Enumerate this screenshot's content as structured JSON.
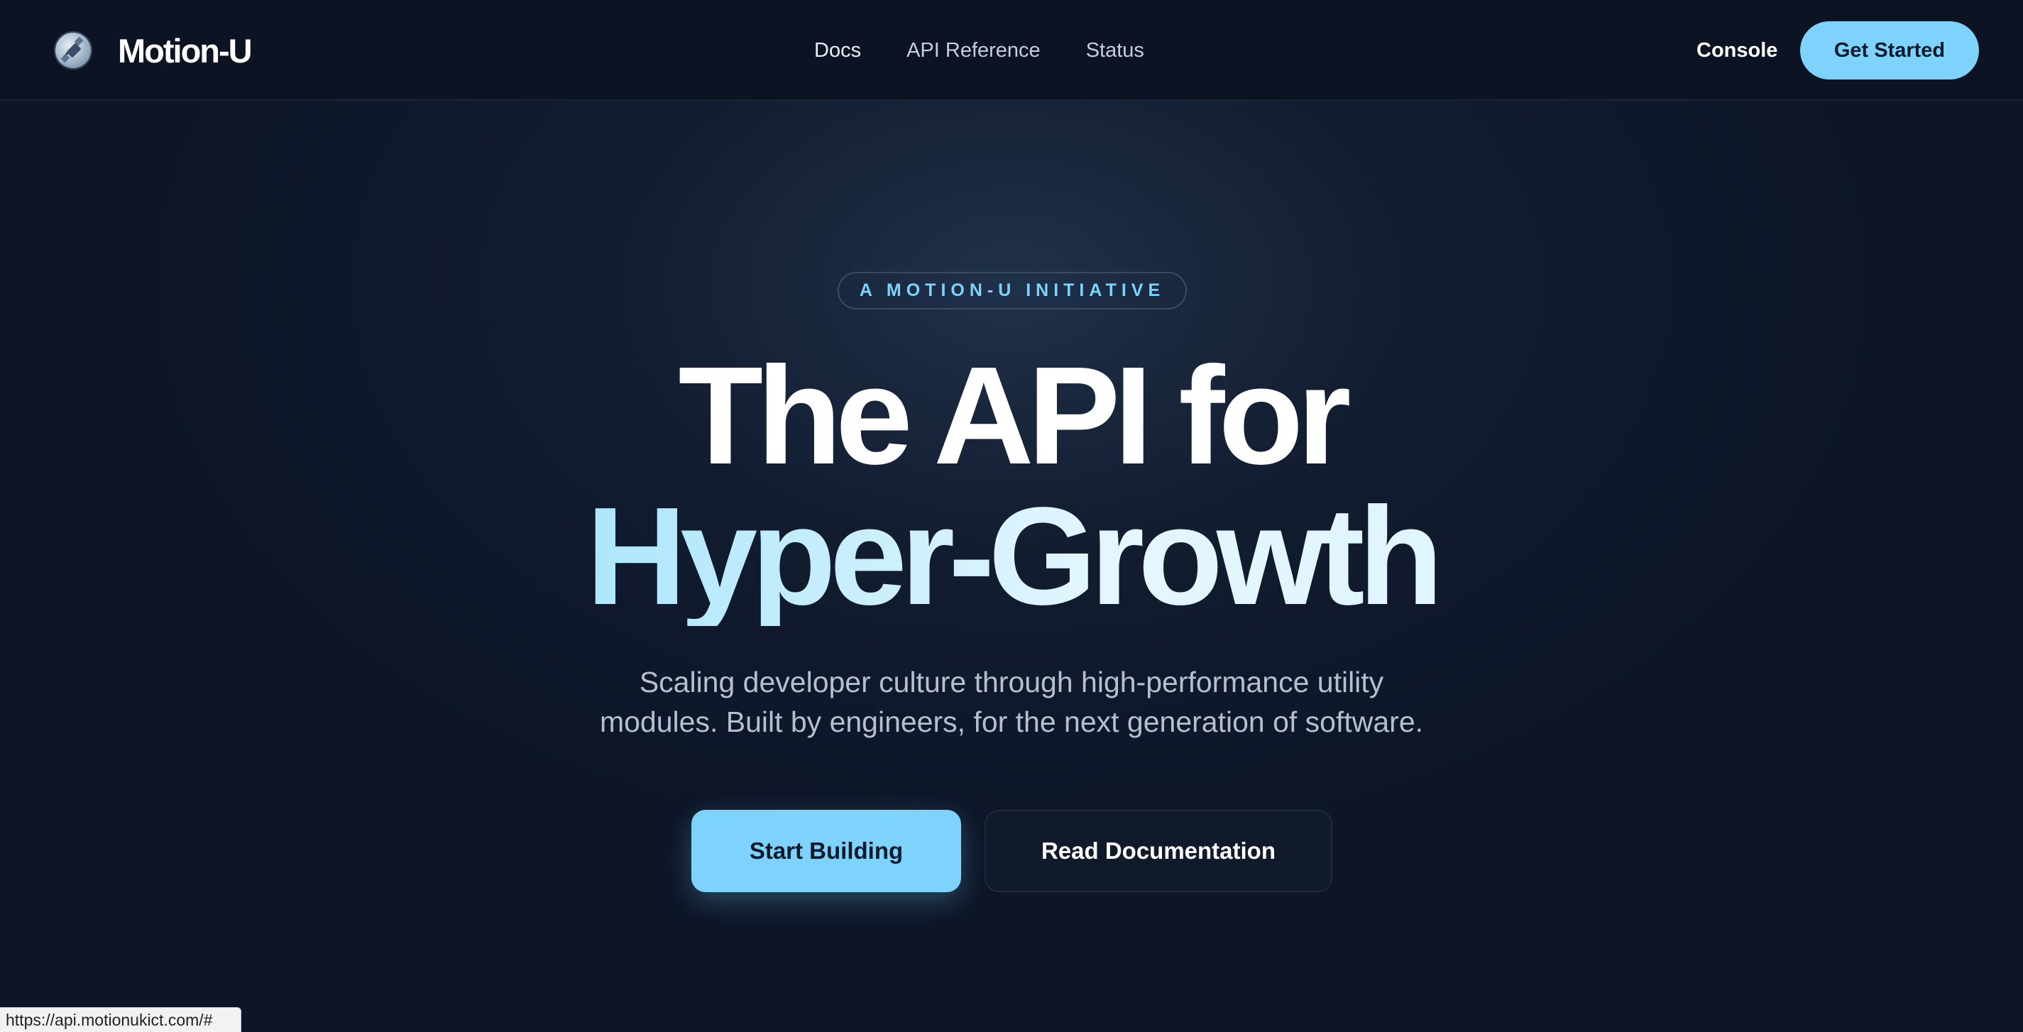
{
  "header": {
    "brand_name": "Motion-U",
    "logo_icon": "satellite-globe-icon",
    "nav": [
      {
        "label": "Docs",
        "active": true
      },
      {
        "label": "API Reference",
        "active": false
      },
      {
        "label": "Status",
        "active": false
      }
    ],
    "console_label": "Console",
    "get_started_label": "Get Started"
  },
  "hero": {
    "badge": "A MOTION-U INITIATIVE",
    "headline_line1": "The API for",
    "headline_line2": "Hyper-Growth",
    "subtitle_line1": "Scaling developer culture through high-performance utility",
    "subtitle_line2": "modules. Built by engineers, for the next generation of software.",
    "primary_cta": "Start Building",
    "secondary_cta": "Read Documentation"
  },
  "status_bar": {
    "url": "https://api.motionukict.com/#"
  },
  "colors": {
    "background": "#0d1526",
    "accent": "#7dd3fc",
    "text_primary": "#ffffff",
    "text_secondary": "#b5c0cf"
  }
}
